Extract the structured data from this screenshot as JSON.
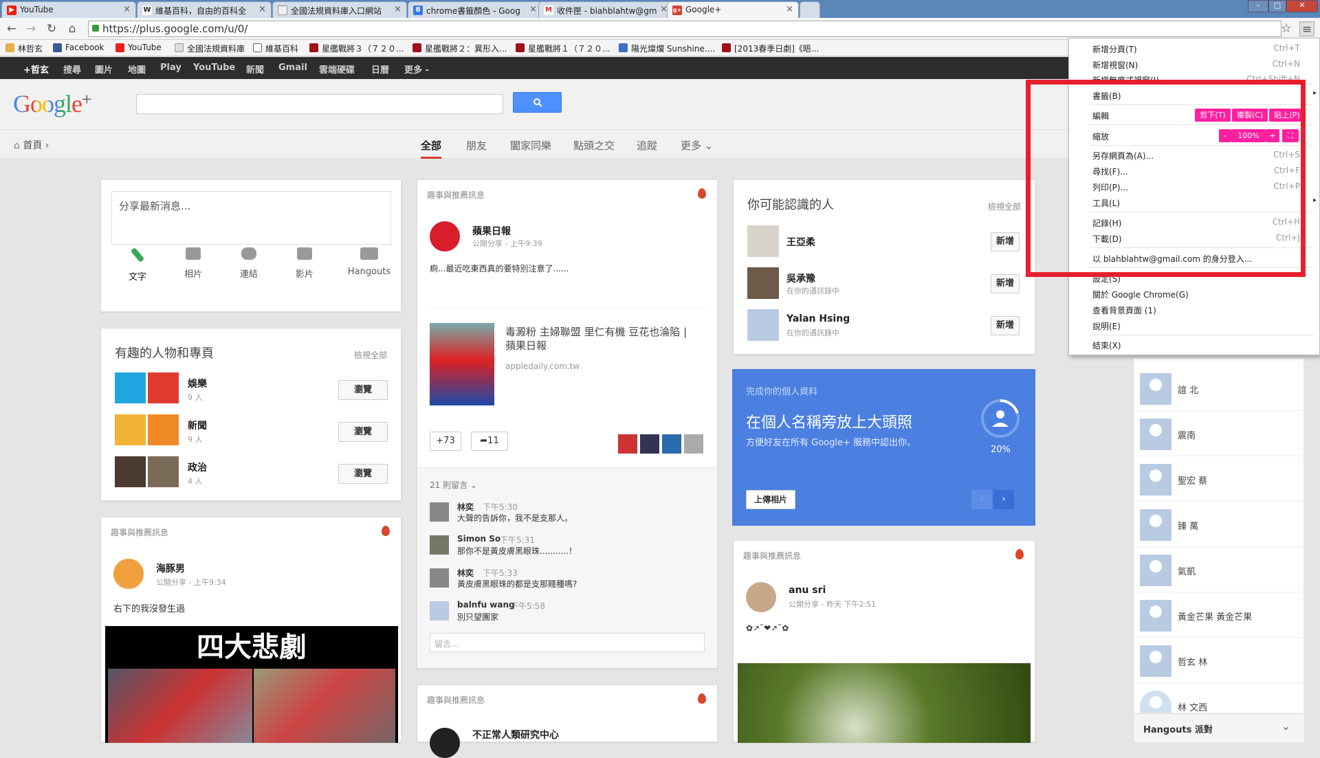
{
  "tabs": [
    {
      "title": "YouTube",
      "color": "#e62117",
      "glyph": "▶"
    },
    {
      "title": "維基百科，自由的百科全",
      "color": "#222",
      "glyph": "W"
    },
    {
      "title": "全國法規資料庫入口網站",
      "color": "#999",
      "glyph": "▭"
    },
    {
      "title": "chrome書籤顏色 - Goog",
      "color": "#3b78e7",
      "glyph": "8"
    },
    {
      "title": "收件匣 - blahblahtw@gm",
      "color": "#d93025",
      "glyph": "M"
    },
    {
      "title": "Google+",
      "color": "#d23f31",
      "glyph": "g+"
    }
  ],
  "url": "https://plus.google.com/u/0/",
  "bookmarks": [
    {
      "label": "林哲玄",
      "color": "#e8b04a"
    },
    {
      "label": "Facebook",
      "color": "#3b5998"
    },
    {
      "label": "YouTube",
      "color": "#e62117"
    },
    {
      "label": "全國法規資料庫",
      "color": "#999"
    },
    {
      "label": "維基百科",
      "color": "#222"
    },
    {
      "label": "星艦戰將３（７２０...",
      "color": "#a0101a"
    },
    {
      "label": "星艦戰將２：異形入...",
      "color": "#a0101a"
    },
    {
      "label": "星艦戰將１（７２０...",
      "color": "#a0101a"
    },
    {
      "label": "陽光燦爛 Sunshine....",
      "color": "#3a6ec9"
    },
    {
      "label": "[2013春季日劇]《晤...",
      "color": "#a0101a"
    }
  ],
  "gbar": [
    "+哲玄",
    "搜尋",
    "圖片",
    "地圖",
    "Play",
    "YouTube",
    "新聞",
    "Gmail",
    "雲端硬碟",
    "日曆",
    "更多 -"
  ],
  "header": {
    "logo_g": "Google",
    "logo_plus": "+",
    "search_icon": "search-icon"
  },
  "subnav": {
    "home": "首頁",
    "tabs": [
      "全部",
      "朋友",
      "闔家同樂",
      "點頭之交",
      "追蹤",
      "更多"
    ]
  },
  "share": {
    "placeholder": "分享最新消息...",
    "tools": [
      "文字",
      "相片",
      "連結",
      "影片",
      "Hangouts"
    ]
  },
  "interesting": {
    "title": "有趣的人物和專頁",
    "view_all": "檢視全部",
    "items": [
      {
        "name": "娛樂",
        "count": "9 人",
        "button": "瀏覽"
      },
      {
        "name": "新聞",
        "count": "9 人",
        "button": "瀏覽"
      },
      {
        "name": "政治",
        "count": "4 人",
        "button": "瀏覽"
      }
    ]
  },
  "post_left": {
    "header": "趣事與推薦訊息",
    "author": "海豚男",
    "meta": "公開分享 - 上午9:34",
    "text": "右下的我沒發生過",
    "image_title": "四大悲劇"
  },
  "post_mid": {
    "header": "趣事與推薦訊息",
    "author": "蘋果日報",
    "meta": "公開分享 - 上午9:39",
    "text": "痾...最近吃東西真的要特別注意了......",
    "link_title_1": "毒澱粉 主婦聯盟 里仁有機 豆花也淪陷 |",
    "link_title_2": "蘋果日報",
    "link_domain": "appledaily.com.tw",
    "plus": "+73",
    "shares": "11",
    "comments_count": "21 則留言",
    "comments": [
      {
        "name": "林奕",
        "time": "下午5:30",
        "text": "大聲的告訴你，我不是支那人。"
      },
      {
        "name": "Simon So",
        "time": "下午5:31",
        "text": "那你不是黃皮膚黑眼珠...........！"
      },
      {
        "name": "林奕",
        "time": "下午5:33",
        "text": "黃皮膚黑眼珠的都是支那賤種嗎?"
      },
      {
        "name": "balnfu wang",
        "time": "下午5:58",
        "text": "別只望團家"
      }
    ],
    "comment_placeholder": "留言..."
  },
  "post_mid2": {
    "header": "趣事與推薦訊息",
    "author": "不正常人類研究中心"
  },
  "people": {
    "title": "你可能認識的人",
    "view_all": "檢視全部",
    "items": [
      {
        "name": "王亞柔",
        "sub": "",
        "button": "新增"
      },
      {
        "name": "吳承豫",
        "sub": "在你的通訊錄中",
        "button": "新增"
      },
      {
        "name": "Yalan Hsing",
        "sub": "在你的通訊錄中",
        "button": "新增"
      }
    ]
  },
  "profile_card": {
    "small": "完成你的個人資料",
    "title": "在個人名稱旁放上大頭照",
    "sub": "方便好友在所有 Google+ 服務中認出你。",
    "percent": "20%",
    "percent_value": 0.2,
    "upload": "上傳相片"
  },
  "post_right": {
    "header": "趣事與推薦訊息",
    "author": "anu sri",
    "meta": "公開分享 - 昨天 下午2:51",
    "text": "✿↗˜❤↗˜✿"
  },
  "hangout_people": [
    "誼 北",
    "震南",
    "聖宏 蔡",
    "臻 萬",
    "氣凱",
    "黃金芒果 黃金芒果",
    "哲玄 林",
    "林 文西"
  ],
  "hangouts_label": "Hangouts 派對",
  "menu": {
    "items": [
      {
        "label": "新增分頁(T)",
        "shortcut": "Ctrl+T"
      },
      {
        "label": "新增視窗(N)",
        "shortcut": "Ctrl+N"
      },
      {
        "label": "新增無痕式視窗(I)",
        "shortcut": "Ctrl+Shift+N"
      },
      {
        "label": "書籤(B)",
        "shortcut": ""
      },
      {
        "label": "編輯",
        "shortcut": ""
      },
      {
        "label": "縮放",
        "shortcut": ""
      },
      {
        "label": "另存網頁為(A)...",
        "shortcut": "Ctrl+S"
      },
      {
        "label": "尋找(F)...",
        "shortcut": "Ctrl+F"
      },
      {
        "label": "列印(P)...",
        "shortcut": "Ctrl+P"
      },
      {
        "label": "工具(L)",
        "shortcut": ""
      },
      {
        "label": "記錄(H)",
        "shortcut": "Ctrl+H"
      },
      {
        "label": "下載(D)",
        "shortcut": "Ctrl+J"
      },
      {
        "label": "以 blahblahtw@gmail.com 的身分登入...",
        "shortcut": ""
      },
      {
        "label": "設定(S)",
        "shortcut": ""
      },
      {
        "label": "關於 Google Chrome(G)",
        "shortcut": ""
      },
      {
        "label": "查看背景頁面 (1)",
        "shortcut": ""
      },
      {
        "label": "說明(E)",
        "shortcut": ""
      },
      {
        "label": "結束(X)",
        "shortcut": ""
      }
    ],
    "edit_buttons": [
      "剪下(T)",
      "複製(C)",
      "貼上(P)"
    ],
    "zoom": {
      "minus": "-",
      "value": "100%",
      "plus": "+",
      "full": "⛶"
    }
  }
}
